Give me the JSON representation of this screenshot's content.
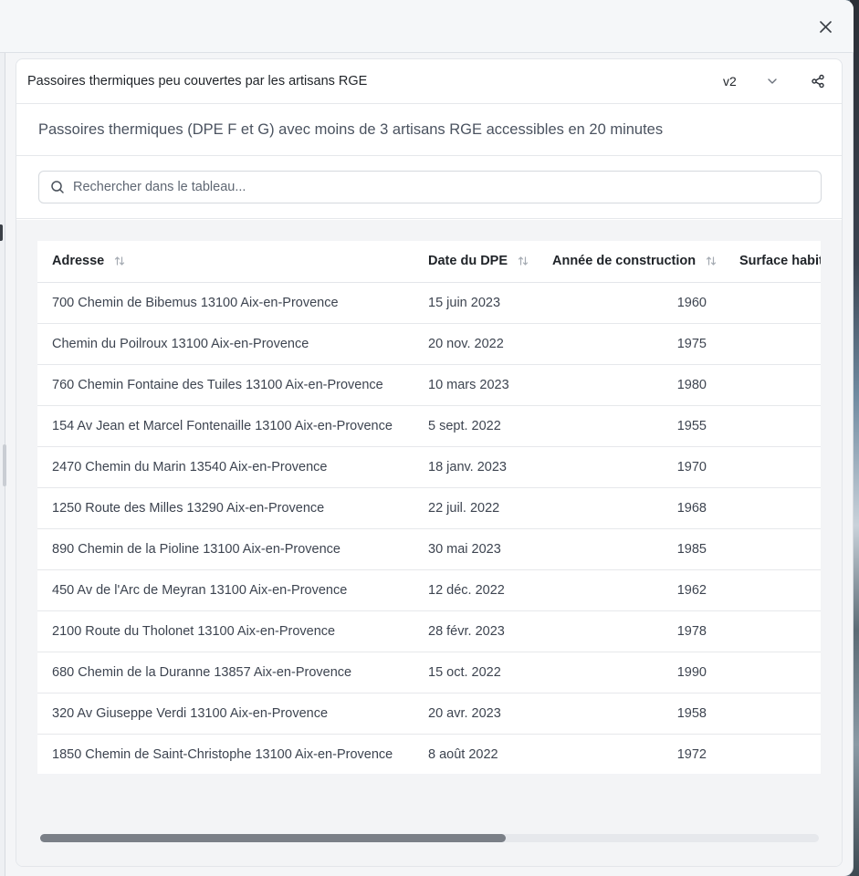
{
  "close_icon": "close-icon",
  "card": {
    "title": "Passoires thermiques peu couvertes par les artisans RGE",
    "version": "v2",
    "subtitle": "Passoires thermiques (DPE F et G) avec moins de 3 artisans RGE accessibles en 20 minutes"
  },
  "search": {
    "placeholder": "Rechercher dans le tableau...",
    "value": ""
  },
  "table": {
    "headers": {
      "address": "Adresse",
      "date": "Date du DPE",
      "year": "Année de construction",
      "surface": "Surface habitable"
    },
    "rows": [
      {
        "address": "700 Chemin de Bibemus 13100 Aix-en-Provence",
        "date": "15 juin 2023",
        "year": "1960"
      },
      {
        "address": "Chemin du Poilroux 13100 Aix-en-Provence",
        "date": "20 nov. 2022",
        "year": "1975"
      },
      {
        "address": "760 Chemin Fontaine des Tuiles 13100 Aix-en-Provence",
        "date": "10 mars 2023",
        "year": "1980"
      },
      {
        "address": "154 Av Jean et Marcel Fontenaille 13100 Aix-en-Provence",
        "date": "5 sept. 2022",
        "year": "1955"
      },
      {
        "address": "2470 Chemin du Marin 13540 Aix-en-Provence",
        "date": "18 janv. 2023",
        "year": "1970"
      },
      {
        "address": "1250 Route des Milles 13290 Aix-en-Provence",
        "date": "22 juil. 2022",
        "year": "1968"
      },
      {
        "address": "890 Chemin de la Pioline 13100 Aix-en-Provence",
        "date": "30 mai 2023",
        "year": "1985"
      },
      {
        "address": "450 Av de l'Arc de Meyran 13100 Aix-en-Provence",
        "date": "12 déc. 2022",
        "year": "1962"
      },
      {
        "address": "2100 Route du Tholonet 13100 Aix-en-Provence",
        "date": "28 févr. 2023",
        "year": "1978"
      },
      {
        "address": "680 Chemin de la Duranne 13857 Aix-en-Provence",
        "date": "15 oct. 2022",
        "year": "1990"
      },
      {
        "address": "320 Av Giuseppe Verdi 13100 Aix-en-Provence",
        "date": "20 avr. 2023",
        "year": "1958"
      },
      {
        "address": "1850 Chemin de Saint-Christophe 13100 Aix-en-Provence",
        "date": "8 août 2022",
        "year": "1972"
      }
    ]
  },
  "horizontal_scroll_fraction": 0.0
}
